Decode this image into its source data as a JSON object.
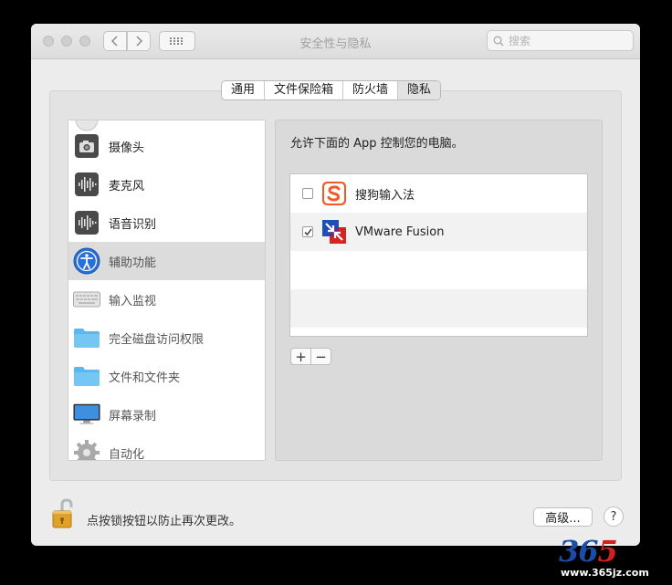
{
  "window": {
    "title": "安全性与隐私"
  },
  "search": {
    "placeholder": "搜索"
  },
  "tabs": [
    "通用",
    "文件保险箱",
    "防火墙",
    "隐私"
  ],
  "sidebar": {
    "items": [
      {
        "label": "摄像头",
        "icon": "camera-icon"
      },
      {
        "label": "麦克风",
        "icon": "microphone-icon"
      },
      {
        "label": "语音识别",
        "icon": "speech-recognition-icon"
      },
      {
        "label": "辅助功能",
        "icon": "accessibility-icon",
        "selected": true
      },
      {
        "label": "输入监视",
        "icon": "keyboard-icon"
      },
      {
        "label": "完全磁盘访问权限",
        "icon": "folder-icon"
      },
      {
        "label": "文件和文件夹",
        "icon": "folder-icon"
      },
      {
        "label": "屏幕录制",
        "icon": "display-icon"
      },
      {
        "label": "自动化",
        "icon": "gear-icon"
      }
    ]
  },
  "main": {
    "description": "允许下面的 App 控制您的电脑。",
    "apps": [
      {
        "name": "搜狗输入法",
        "checked": false,
        "icon": "sogou-icon"
      },
      {
        "name": "VMware Fusion",
        "checked": true,
        "icon": "vmware-fusion-icon"
      }
    ],
    "add_label": "+",
    "remove_label": "−"
  },
  "footer": {
    "lock_text": "点按锁按钮以防止再次更改。",
    "advanced_label": "高级...",
    "help_label": "?"
  },
  "watermark": {
    "number_a": "36",
    "number_b": "5",
    "url": "www.365jz.com"
  },
  "colors": {
    "accessibility_blue": "#2a6fd6",
    "folder_blue": "#5bb8ee",
    "sogou_orange": "#f05a28",
    "lock_gold": "#e0a12b"
  }
}
